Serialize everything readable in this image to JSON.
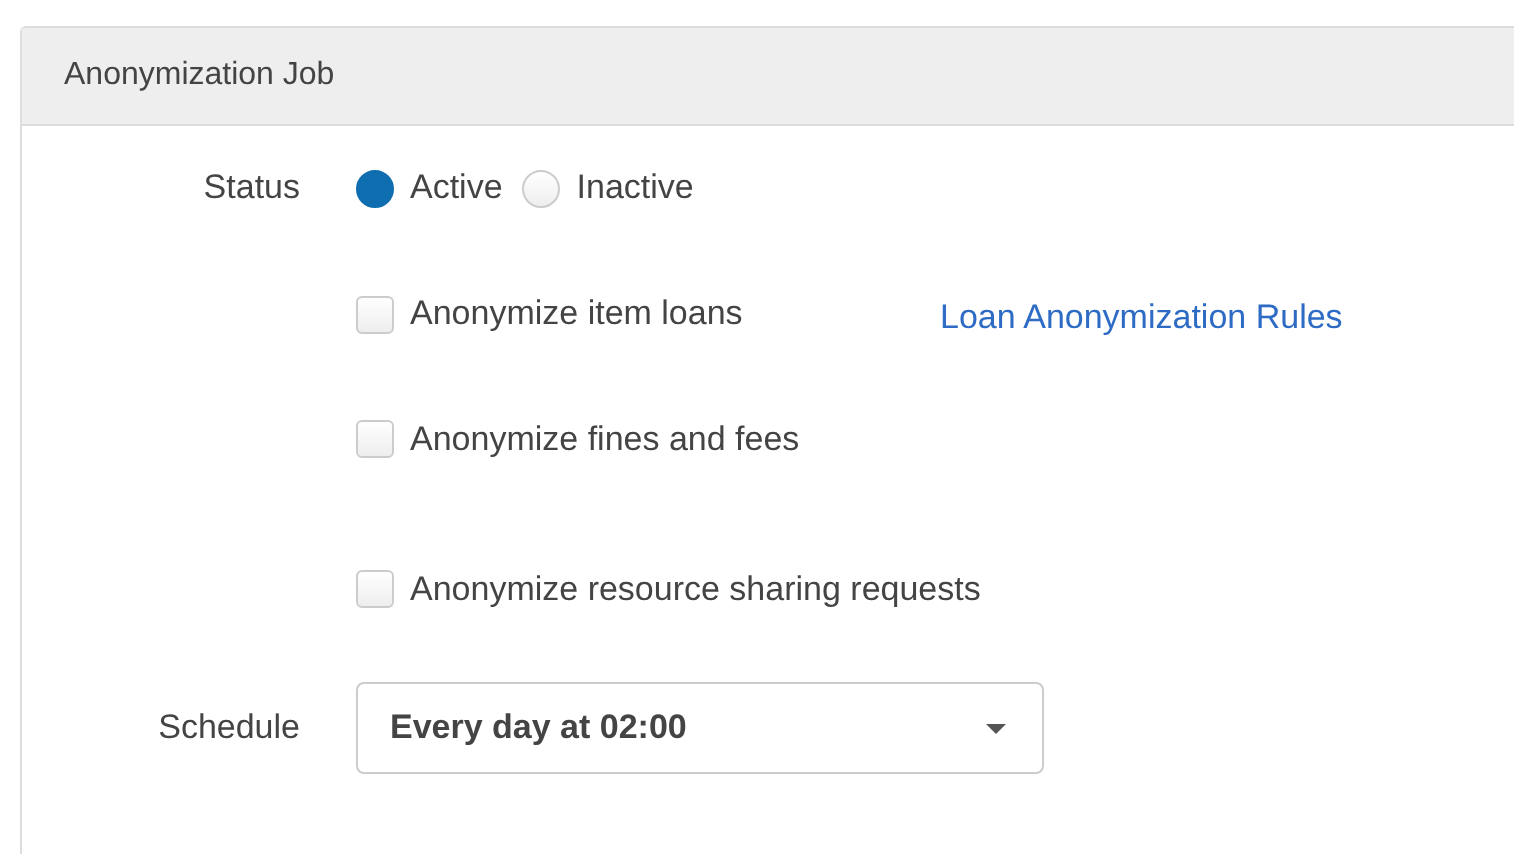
{
  "panel": {
    "title": "Anonymization Job"
  },
  "status": {
    "label": "Status",
    "options": [
      {
        "label": "Active",
        "selected": true
      },
      {
        "label": "Inactive",
        "selected": false
      }
    ]
  },
  "options": [
    {
      "label": "Anonymize item loans",
      "checked": false,
      "link": "Loan Anonymization Rules"
    },
    {
      "label": "Anonymize fines and fees",
      "checked": false
    },
    {
      "label": "Anonymize resource sharing requests",
      "checked": false
    }
  ],
  "schedule": {
    "label": "Schedule",
    "value": "Every day at 02:00"
  }
}
